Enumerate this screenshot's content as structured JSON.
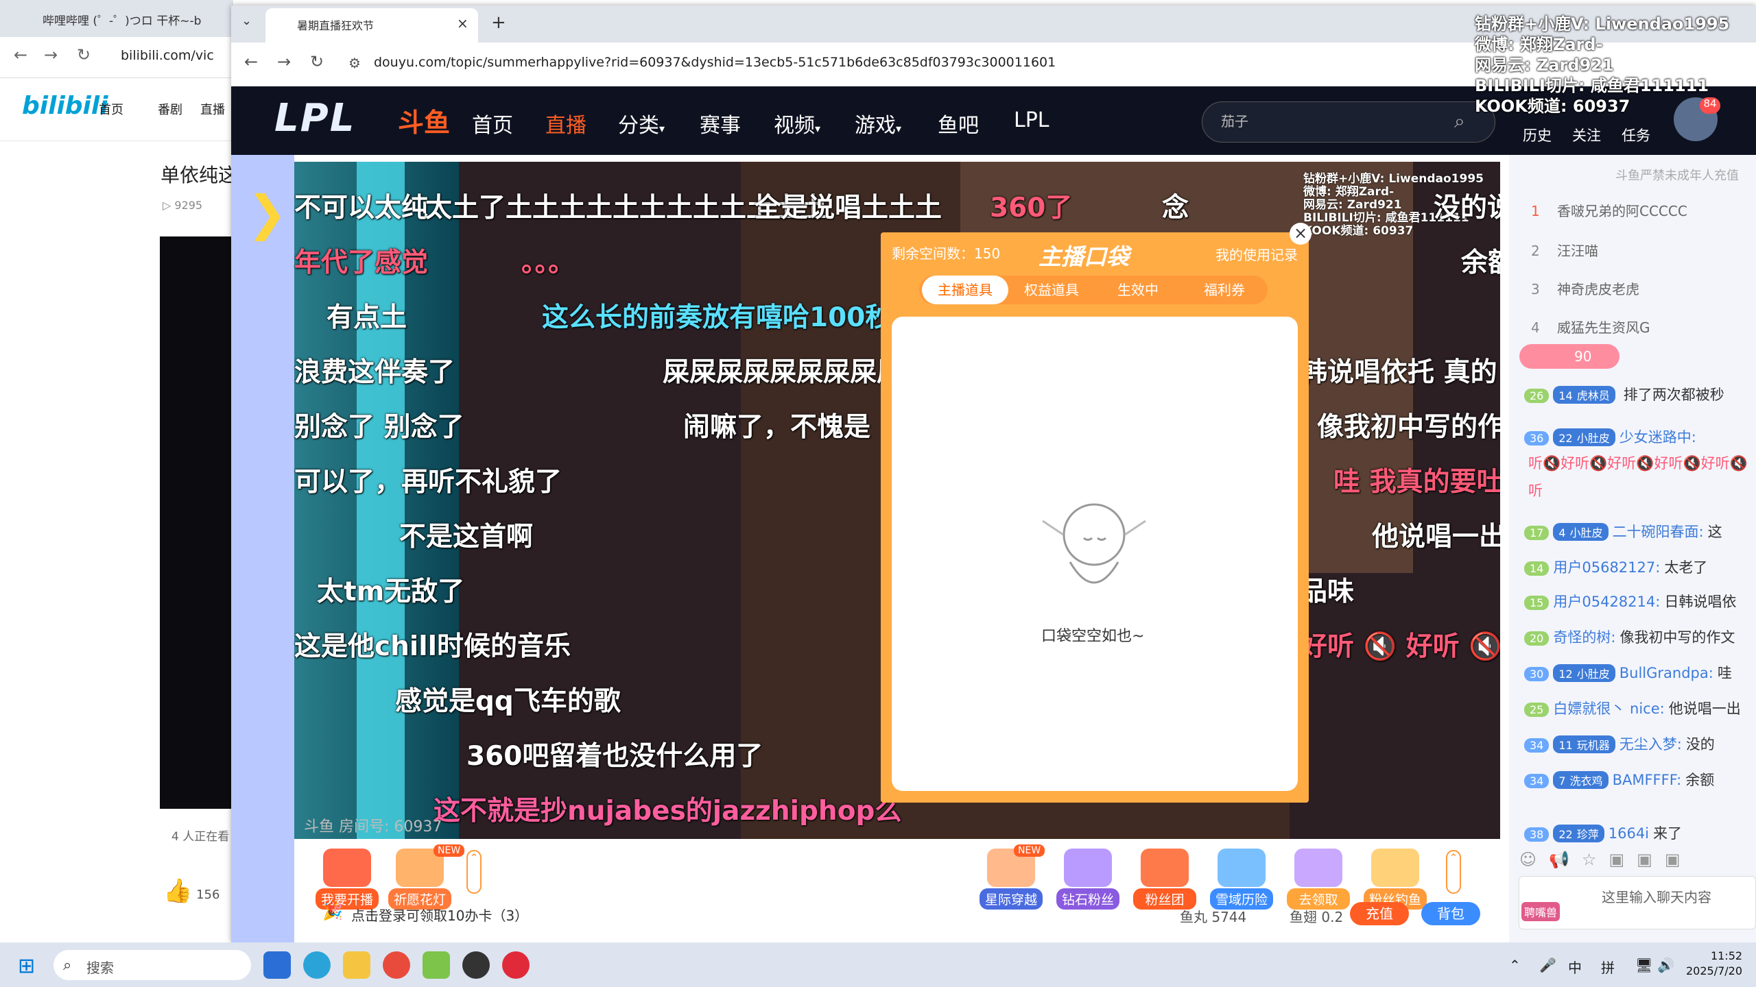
{
  "bg_window": {
    "tab_title": "哔哩哔哩 (゜-゜)つロ 干杯~-b",
    "url": "bilibili.com/vic",
    "logo": "bilibili",
    "nav": [
      "首页",
      "番剧",
      "直播"
    ],
    "video_title": "单依纯这",
    "views": "9295",
    "watching": "4 人正在看",
    "likes": "156"
  },
  "browser": {
    "tab_title": "暑期直播狂欢节",
    "url": "douyu.com/topic/summerhappylive?rid=60937&dyshid=13ecb5-51c571b6de63c85df03793c300011601"
  },
  "douyu_header": {
    "logo_left": "LPL",
    "logo_right": "斗鱼",
    "nav": [
      "首页",
      "直播",
      "分类",
      "赛事",
      "视频",
      "游戏",
      "鱼吧",
      "LPL"
    ],
    "search_value": "茄子",
    "links": [
      "历史",
      "关注",
      "任务"
    ],
    "avatar_badge": "84"
  },
  "overlay_text": [
    "钻粉群+小鹿V: Liwendao1995",
    "微博: 郑翔Zard-",
    "网易云: Zard921",
    "BILIBILI切片: 咸鱼君111111",
    "KOOK频道: 60937"
  ],
  "danmaku": [
    {
      "text": "不可以太纯",
      "cls": ""
    },
    {
      "text": "太土了土土土土土土土土土土土土",
      "cls": ""
    },
    {
      "text": "全是说唱土土土",
      "cls": ""
    },
    {
      "text": "360了",
      "cls": "dm-red"
    },
    {
      "text": "念",
      "cls": ""
    },
    {
      "text": "没的说",
      "cls": ""
    },
    {
      "text": "年代了感觉",
      "cls": "dm-red"
    },
    {
      "text": "。。。",
      "cls": "dm-red"
    },
    {
      "text": "余额",
      "cls": ""
    },
    {
      "text": "有点土",
      "cls": ""
    },
    {
      "text": "这么长的前奏放有嘻哈100秒",
      "cls": "dm-blue"
    },
    {
      "text": "浪费这伴奏了",
      "cls": ""
    },
    {
      "text": "屎屎屎屎屎屎屎屎屎",
      "cls": ""
    },
    {
      "text": "韩说唱依托 真的",
      "cls": ""
    },
    {
      "text": "别念了 别念了",
      "cls": ""
    },
    {
      "text": "闹嘛了，不愧是",
      "cls": ""
    },
    {
      "text": "像我初中写的作",
      "cls": ""
    },
    {
      "text": "可以了，再听不礼貌了",
      "cls": ""
    },
    {
      "text": "哇 我真的要吐",
      "cls": "dm-red"
    },
    {
      "text": "不是这首啊",
      "cls": ""
    },
    {
      "text": "他说唱一出",
      "cls": ""
    },
    {
      "text": "太tm无敌了",
      "cls": ""
    },
    {
      "text": "品味",
      "cls": ""
    },
    {
      "text": "这是他chill时候的音乐",
      "cls": ""
    },
    {
      "text": "好听 🔇 好听 🔇 好",
      "cls": "dm-red"
    },
    {
      "text": "感觉是qq飞车的歌",
      "cls": ""
    },
    {
      "text": "360吧留着也没什么用了",
      "cls": ""
    },
    {
      "text": "这不就是抄nujabes的jazzhiphop么",
      "cls": "dm-pink"
    }
  ],
  "room_no": "斗鱼 房间号: 60937",
  "pocket": {
    "capacity": "剩余空间数：150",
    "title": "主播口袋",
    "record": "我的使用记录",
    "tabs": [
      "主播道具",
      "权益道具",
      "生效中",
      "福利券"
    ],
    "empty_text": "口袋空空如也~",
    "close": "×"
  },
  "gifts_left": [
    {
      "label": "我要开播",
      "badge": ""
    },
    {
      "label": "祈愿花灯",
      "badge": "NEW"
    }
  ],
  "gifts_right": [
    {
      "label": "星际穿越",
      "badge": "NEW"
    },
    {
      "label": "钻石粉丝",
      "badge": ""
    },
    {
      "label": "粉丝团",
      "badge": ""
    },
    {
      "label": "雪域历险",
      "badge": ""
    },
    {
      "label": "去领取",
      "badge": ""
    },
    {
      "label": "粉丝钓鱼",
      "badge": ""
    }
  ],
  "giftbar": {
    "login_tip": "点击登录可领取10办卡（3）",
    "yuwan": "鱼丸 5744",
    "yuchi": "鱼翅 0.2",
    "recharge": "充值",
    "bag": "背包"
  },
  "chat": {
    "notice": "斗鱼严禁未成年人充值",
    "ranks": [
      {
        "n": "1",
        "name": "香啵兄弟的阿CCCCC"
      },
      {
        "n": "2",
        "name": "汪汪喵"
      },
      {
        "n": "3",
        "name": "神奇虎皮老虎"
      },
      {
        "n": "4",
        "name": "威猛先生资风G"
      }
    ],
    "fan_count": "90",
    "messages": [
      {
        "lv": "26",
        "badge_lv": "14",
        "badge": "虎林员",
        "user": "",
        "text": "排了两次都被秒"
      },
      {
        "lv": "36",
        "badge_lv": "22",
        "badge": "小肚皮",
        "user": "少女迷路中:",
        "text": ""
      },
      {
        "lv": "",
        "badge_lv": "",
        "badge": "",
        "user": "",
        "text": "听🔇好听🔇好听🔇好听🔇好听🔇"
      },
      {
        "lv": "",
        "badge_lv": "",
        "badge": "",
        "user": "",
        "text": "听"
      },
      {
        "lv": "17",
        "badge_lv": "4",
        "badge": "小肚皮",
        "user": "二十碗阳春面:",
        "text": "这"
      },
      {
        "lv": "14",
        "badge_lv": "",
        "badge": "",
        "user": "用户05682127:",
        "text": "太老了"
      },
      {
        "lv": "15",
        "badge_lv": "",
        "badge": "",
        "user": "用户05428214:",
        "text": "日韩说唱依"
      },
      {
        "lv": "20",
        "badge_lv": "",
        "badge": "",
        "user": "奇怪的树:",
        "text": "像我初中写的作文"
      },
      {
        "lv": "30",
        "badge_lv": "12",
        "badge": "小肚皮",
        "user": "BullGrandpa:",
        "text": "哇"
      },
      {
        "lv": "25",
        "badge_lv": "",
        "badge": "",
        "user": "白嫖就很丶 nice:",
        "text": "他说唱一出"
      },
      {
        "lv": "34",
        "badge_lv": "11",
        "badge": "玩机器",
        "user": "无尘入梦:",
        "text": "没的"
      },
      {
        "lv": "34",
        "badge_lv": "7",
        "badge": "洗衣鸡",
        "user": "BAMFFFF:",
        "text": "余额"
      },
      {
        "lv": "38",
        "badge_lv": "22",
        "badge": "珍萍",
        "user": "1664i",
        "text": "来了"
      }
    ],
    "input_placeholder": "这里输入聊天内容",
    "input_btn": "聘嘴兽"
  },
  "taskbar": {
    "search": "搜索",
    "tray": [
      "中",
      "拼"
    ],
    "time": "11:52",
    "date": "2025/7/20"
  }
}
